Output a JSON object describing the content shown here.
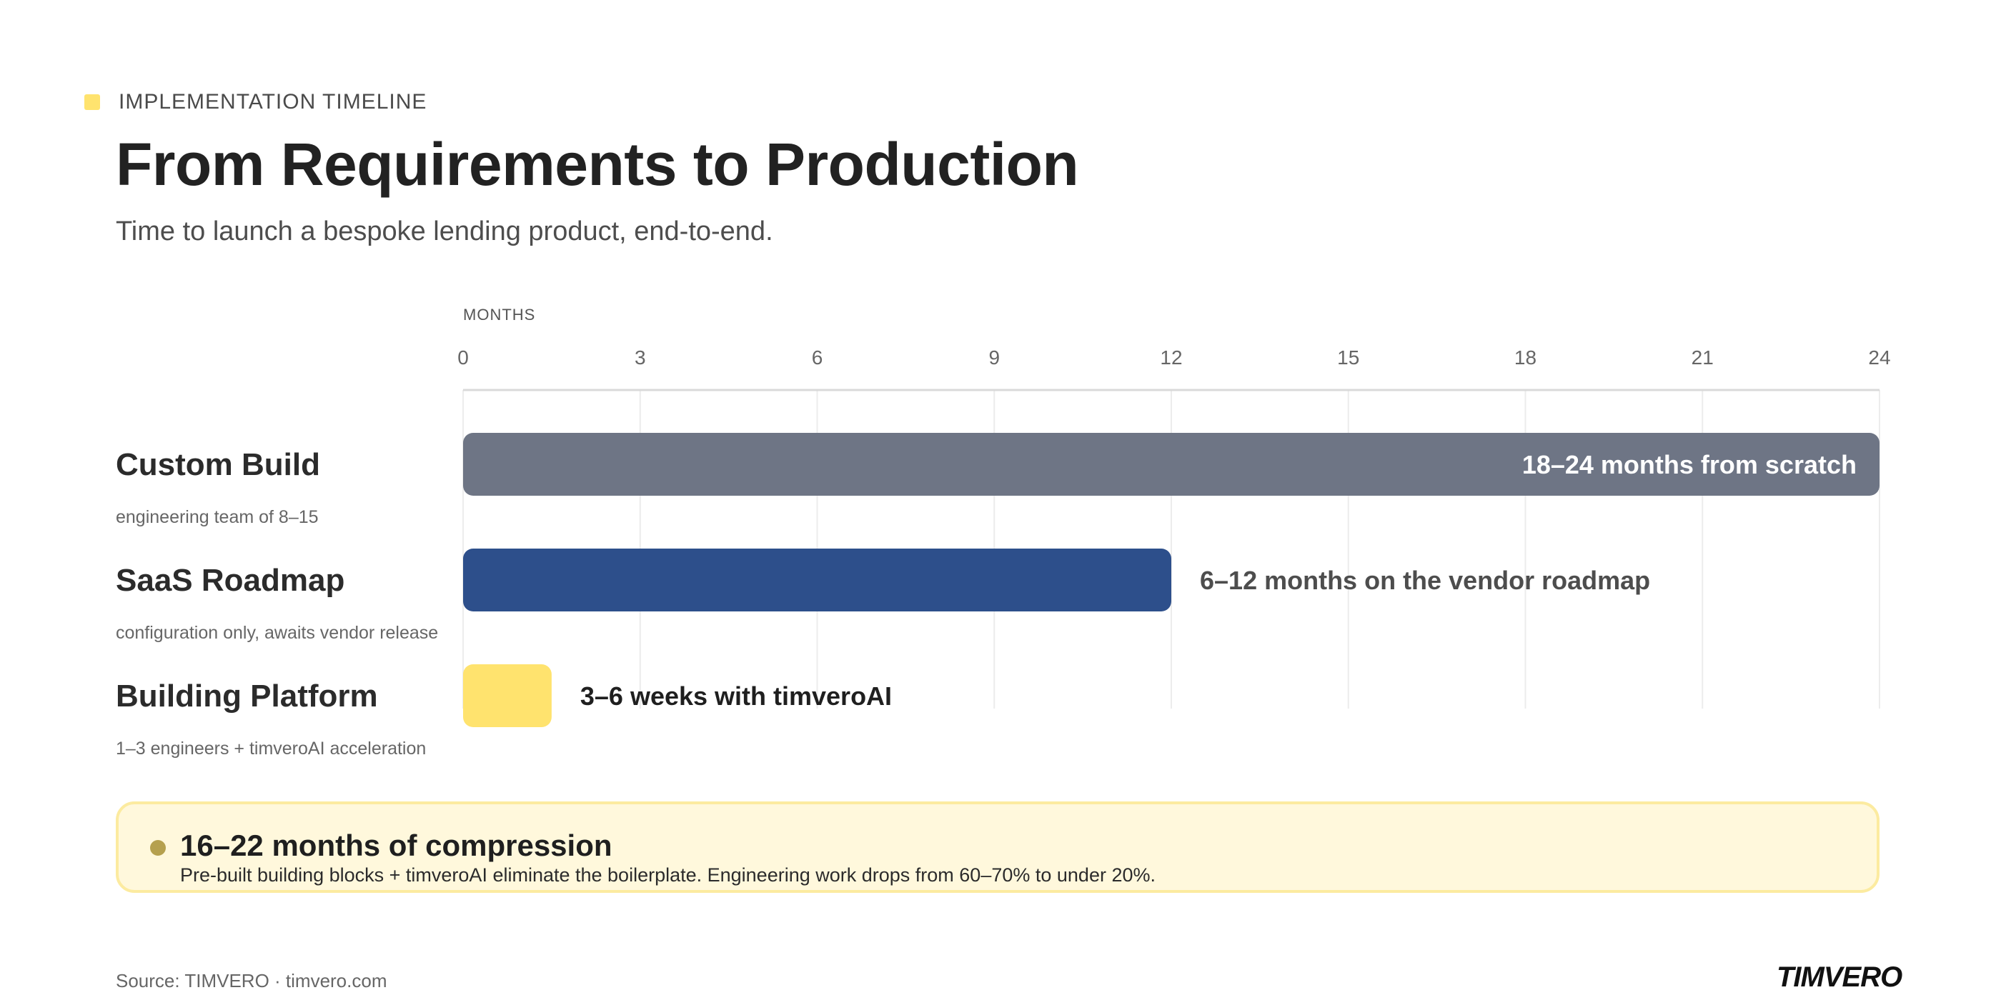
{
  "header": {
    "eyebrow": "IMPLEMENTATION TIMELINE",
    "title": "From Requirements to Production",
    "subtitle": "Time to launch a bespoke lending product, end-to-end."
  },
  "chart_data": {
    "type": "bar",
    "orientation": "horizontal",
    "axis_unit_label": "MONTHS",
    "xlim": [
      0,
      24
    ],
    "xticks": [
      0,
      3,
      6,
      9,
      12,
      15,
      18,
      21,
      24
    ],
    "grid": true,
    "rows": [
      {
        "label": "Custom Build",
        "sublabel": "engineering team of 8–15",
        "start": 0,
        "value": 24,
        "bar_label": "18–24 months from scratch",
        "bar_label_position": "inside",
        "color": "#6E7585"
      },
      {
        "label": "SaaS Roadmap",
        "sublabel": "configuration only, awaits vendor release",
        "start": 0,
        "value": 12,
        "bar_label": "6–12 months on the vendor roadmap",
        "bar_label_position": "outside",
        "color": "#2D4F8B"
      },
      {
        "label": "Building Platform",
        "sublabel": "1–3 engineers + timveroAI acceleration",
        "start": 0,
        "value": 1.5,
        "bar_label": "3–6 weeks with timveroAI",
        "bar_label_position": "outside",
        "color": "#FFE36E"
      }
    ]
  },
  "callout": {
    "title": "16–22 months of compression",
    "body": "Pre-built building blocks + timveroAI eliminate the boilerplate. Engineering work drops from 60–70% to under 20%."
  },
  "footer": {
    "source": "Source: TIMVERO  ·  timvero.com",
    "logo_text": "TIMVERO"
  },
  "colors": {
    "accent_yellow": "#FFE36E",
    "callout_bg": "#FFF8DC",
    "callout_border": "#FCEBA0"
  }
}
